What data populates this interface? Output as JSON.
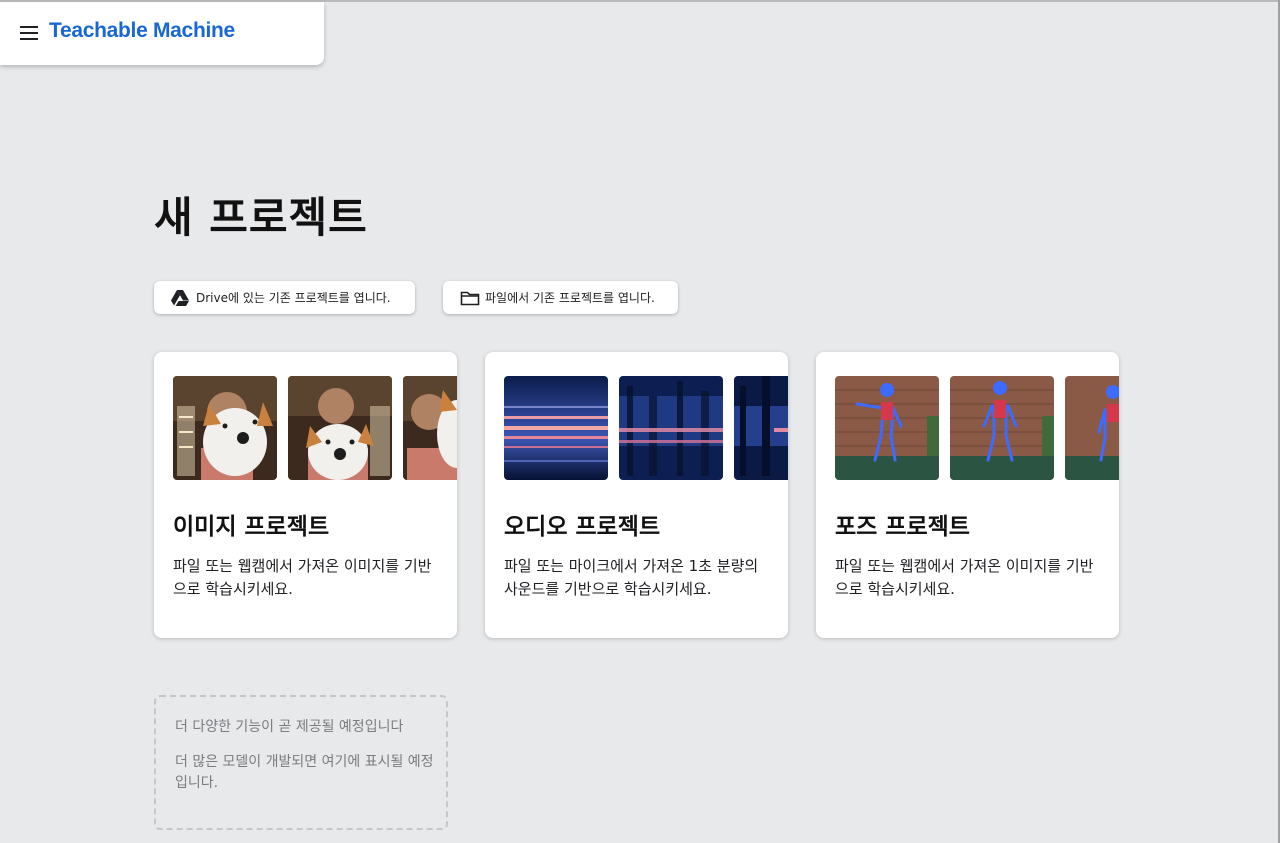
{
  "app": {
    "title": "Teachable Machine"
  },
  "page": {
    "title": "새 프로젝트"
  },
  "open_buttons": {
    "drive": {
      "label": "Drive에 있는 기존 프로젝트를 엽니다.",
      "icon": "google-drive-icon"
    },
    "file": {
      "label": "파일에서 기존 프로젝트를 엽니다.",
      "icon": "folder-icon"
    }
  },
  "project_cards": [
    {
      "title": "이미지 프로젝트",
      "description": "파일 또는 웹캠에서 가져온 이미지를 기반으로 학습시키세요."
    },
    {
      "title": "오디오 프로젝트",
      "description": "파일 또는 마이크에서 가져온 1초 분량의 사운드를 기반으로 학습시키세요."
    },
    {
      "title": "포즈 프로젝트",
      "description": "파일 또는 웹캠에서 가져온 이미지를 기반으로 학습시키세요."
    }
  ],
  "coming_soon": {
    "title": "더 다양한 기능이 곧 제공될 예정입니다",
    "description": "더 많은 모델이 개발되면 여기에 표시될 예정입니다."
  },
  "colors": {
    "brand": "#1967d2",
    "background": "#e8e9eb",
    "card": "#ffffff"
  }
}
